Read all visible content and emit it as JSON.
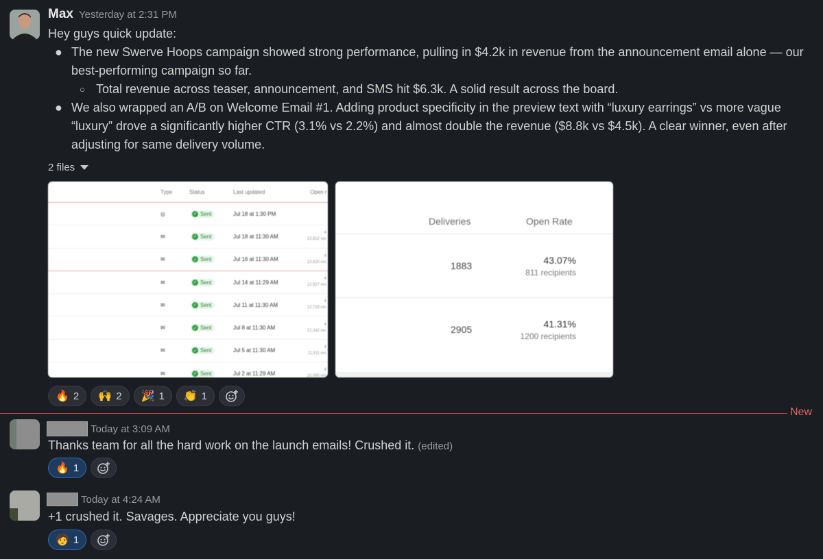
{
  "messages": [
    {
      "author": "Max",
      "timestamp": "Yesterday at 2:31 PM",
      "intro": "Hey guys quick update:",
      "bullets": [
        {
          "text": "The new Swerve Hoops campaign showed strong performance, pulling in $4.2k in revenue from the announcement email alone — our best-performing campaign so far."
        },
        {
          "text": "Total revenue across teaser, announcement, and SMS hit $6.3k. A solid result across the board."
        },
        {
          "text": "We also wrapped an A/B on Welcome Email #1. Adding product specificity in the preview text with “luxury earrings” vs more vague “luxury” drove a significantly higher CTR (3.1% vs 2.2%) and almost double the revenue ($8.8k vs $4.5k). A clear winner, even after adjusting for same delivery volume."
        }
      ],
      "files_label": "2 files",
      "file1": {
        "headers": {
          "type": "Type",
          "status": "Status",
          "updated": "Last updated",
          "open": "Open r"
        },
        "rows": [
          {
            "status": "Sent",
            "date": "Jul 18 at 1:30 PM",
            "open_top": "",
            "open_sub": ""
          },
          {
            "status": "Sent",
            "date": "Jul 18 at 11:30 AM",
            "open_top": "4",
            "open_sub": "13,822 rec"
          },
          {
            "status": "Sent",
            "date": "Jul 16 at 11:30 AM",
            "open_top": "4",
            "open_sub": "13,620 rec"
          },
          {
            "status": "Sent",
            "date": "Jul 14 at 11:29 AM",
            "open_top": "4",
            "open_sub": "12,927 rec"
          },
          {
            "status": "Sent",
            "date": "Jul 11 at 11:30 AM",
            "open_top": "4",
            "open_sub": "12,733 rec"
          },
          {
            "status": "Sent",
            "date": "Jul 8 at 11:30 AM",
            "open_top": "4",
            "open_sub": "12,342 rec"
          },
          {
            "status": "Sent",
            "date": "Jul 5 at 11:30 AM",
            "open_top": "4",
            "open_sub": "11,511 rec"
          },
          {
            "status": "Sent",
            "date": "Jul 2 at 11:29 AM",
            "open_top": "4",
            "open_sub": "10,090 rec"
          }
        ]
      },
      "file2": {
        "headers": {
          "deliveries": "Deliveries",
          "open_rate": "Open Rate"
        },
        "rows": [
          {
            "deliveries": "1883",
            "rate": "43.07%",
            "recipients": "811 recipients"
          },
          {
            "deliveries": "2905",
            "rate": "41.31%",
            "recipients": "1200 recipients"
          }
        ]
      },
      "reactions": [
        {
          "emoji": "🔥",
          "count": "2"
        },
        {
          "emoji": "🙌",
          "count": "2"
        },
        {
          "emoji": "🎉",
          "count": "1"
        },
        {
          "emoji": "👏",
          "count": "1"
        }
      ]
    },
    {
      "timestamp": "Today at 3:09 AM",
      "text": "Thanks team for all the hard work on the launch emails! Crushed it.",
      "edited": "(edited)",
      "reactions": [
        {
          "emoji": "🔥",
          "count": "1"
        }
      ]
    },
    {
      "timestamp": "Today at 4:24 AM",
      "text": "+1 crushed it. Savages. Appreciate you guys!",
      "reactions": [
        {
          "emoji": "🧑",
          "count": "1"
        }
      ]
    }
  ],
  "divider_label": "New",
  "colors": {
    "background": "#1a1d21",
    "new_divider": "#b5474b",
    "reaction_mine": "#1d3b5e"
  }
}
